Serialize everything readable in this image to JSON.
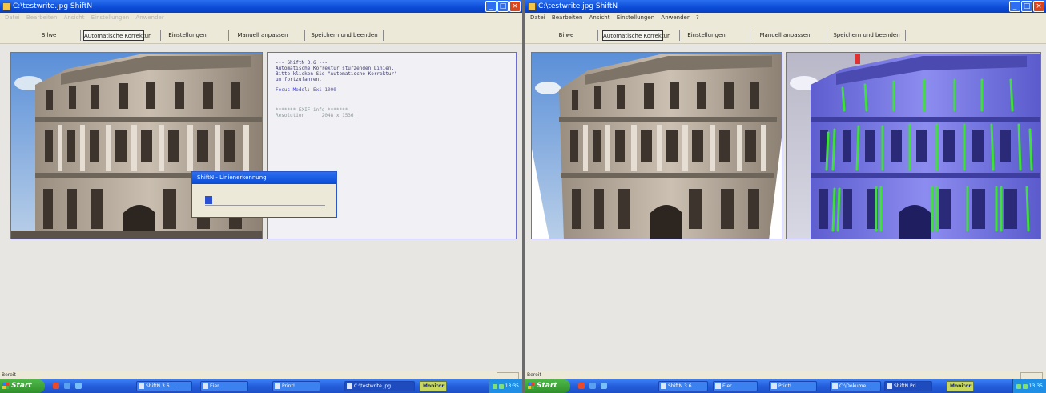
{
  "left": {
    "window_title": "C:\\testwrite.jpg  ShiftN",
    "menu": [
      "Datei",
      "Bearbeiten",
      "Ansicht",
      "Einstellungen",
      "Anwender"
    ],
    "toolbar": [
      "Bilwe",
      "Automatische Korrektur",
      "Einstellungen",
      "Manuell anpassen",
      "Speichern und beenden"
    ],
    "info": {
      "header": "--- ShiftN 3.6 ---",
      "lines": [
        "Automatische Korrektur stürzenden Linien.",
        "Bitte klicken Sie \"Automatische Korrektur\"",
        "um fortzufahren."
      ],
      "focal": "Focus Model: Exi 1000",
      "exif_header": "******* EXIF info *******",
      "exif_line": "Resolution      2048 x 1536"
    },
    "dialog": {
      "title": "ShiftN - Linienerkennung",
      "progress": 0.06
    },
    "status": "Bereit"
  },
  "right": {
    "window_title": "C:\\testwrite.jpg  ShiftN",
    "menu": [
      "Datei",
      "Bearbeiten",
      "Ansicht",
      "Einstellungen",
      "Anwender",
      "?"
    ],
    "toolbar": [
      "Bilwe",
      "Automatische Korrektur",
      "Einstellungen",
      "Manuell anpassen",
      "Speichern und beenden"
    ],
    "status": "Bereit"
  },
  "taskbar": {
    "start_label": "Start",
    "left_tasks": [
      "ShiftN 3.6...",
      "Eier",
      "Print!",
      "C:\\testwrite.jpg..."
    ],
    "right_tasks": [
      "ShiftN 3.6...",
      "Eier",
      "Print!",
      "C:\\Dokume...",
      "ShiftN Pri..."
    ],
    "monitor_label": "Monitor",
    "clock": "13:35"
  },
  "colors": {
    "titlebar": "#0b4bd6",
    "highlight_lines": "#3fe03a",
    "tint": "#7d7df0"
  }
}
